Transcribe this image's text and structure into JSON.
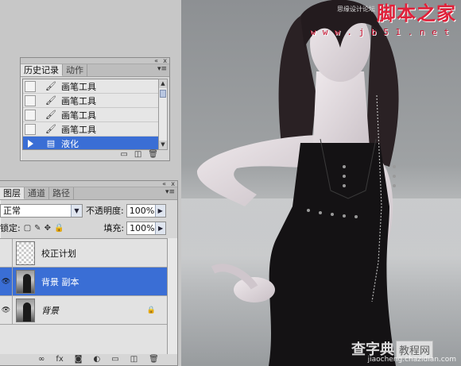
{
  "canvas": {
    "site_logo": "脚本之家",
    "site_url": "w w w . j b 5 1 . n e t",
    "site_small_text": "思缘设计论坛",
    "watermark_main": "查字典",
    "watermark_badge": "教程网",
    "watermark_url": "jiaocheng.chazidian.com"
  },
  "history_panel": {
    "collapse_icon": "«",
    "close_icon": "x",
    "menu_icon": "▾≡",
    "tabs": [
      {
        "label": "历史记录",
        "active": true
      },
      {
        "label": "动作",
        "active": false
      }
    ],
    "items": [
      {
        "icon": "brush-icon",
        "label": "画笔工具",
        "selected": false
      },
      {
        "icon": "brush-icon",
        "label": "画笔工具",
        "selected": false
      },
      {
        "icon": "brush-icon",
        "label": "画笔工具",
        "selected": false
      },
      {
        "icon": "brush-icon",
        "label": "画笔工具",
        "selected": false
      },
      {
        "icon": "liquify-icon",
        "label": "液化",
        "selected": true
      }
    ],
    "footer_icons": [
      "new-document-icon",
      "snapshot-icon",
      "trash-icon"
    ]
  },
  "layers_panel": {
    "collapse_icon": "«",
    "close_icon": "x",
    "menu_icon": "▾≡",
    "tabs": [
      {
        "label": "图层",
        "active": true
      },
      {
        "label": "通道",
        "active": false
      },
      {
        "label": "路径",
        "active": false
      }
    ],
    "blend_mode": "正常",
    "opacity_label": "不透明度:",
    "opacity_value": "100%",
    "lock_label": "锁定:",
    "fill_label": "填充:",
    "fill_value": "100%",
    "layers": [
      {
        "name": "校正计划",
        "visible": false,
        "thumb": "transparent",
        "selected": false,
        "locked": false
      },
      {
        "name": "背景 副本",
        "visible": true,
        "thumb": "photo",
        "selected": true,
        "locked": false
      },
      {
        "name": "背景",
        "visible": true,
        "thumb": "photo",
        "selected": false,
        "locked": true
      }
    ],
    "footer_icons": [
      "link-icon",
      "fx-icon",
      "mask-icon",
      "adjustment-icon",
      "group-icon",
      "new-layer-icon",
      "trash-icon"
    ]
  }
}
